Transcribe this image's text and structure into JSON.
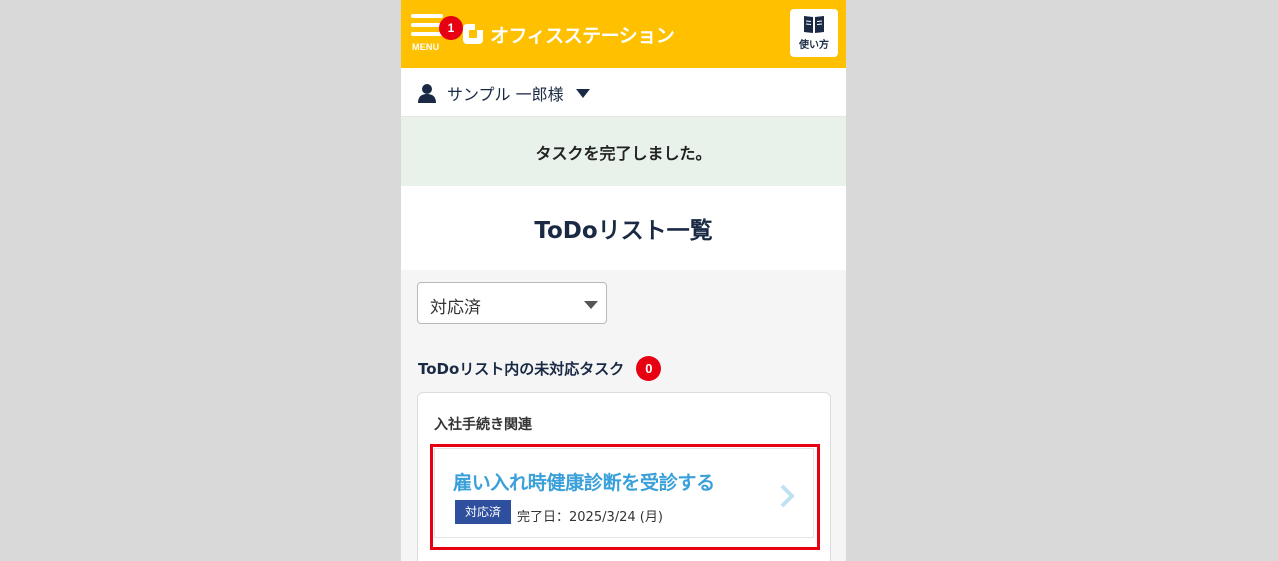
{
  "header": {
    "menu_label": "MENU",
    "notification_count": "1",
    "logo_text": "オフィスステーション",
    "guide_label": "使い方",
    "accent_color": "#ffc000"
  },
  "user": {
    "name": "サンプル 一郎様"
  },
  "flash": {
    "message": "タスクを完了しました。"
  },
  "page": {
    "title": "ToDoリスト一覧"
  },
  "filter": {
    "selected": "対応済"
  },
  "section": {
    "title": "ToDoリスト内の未対応タスク",
    "count": "0"
  },
  "card": {
    "title": "入社手続き関連",
    "tasks": [
      {
        "name": "雇い入れ時健康診断を受診する",
        "status": "対応済",
        "date": "完了日：2025/3/24 (月)"
      }
    ]
  },
  "colors": {
    "badge": "#e60012",
    "task_link": "#3aa0da",
    "status_badge": "#2d4f9e",
    "highlight": "#e60012"
  }
}
